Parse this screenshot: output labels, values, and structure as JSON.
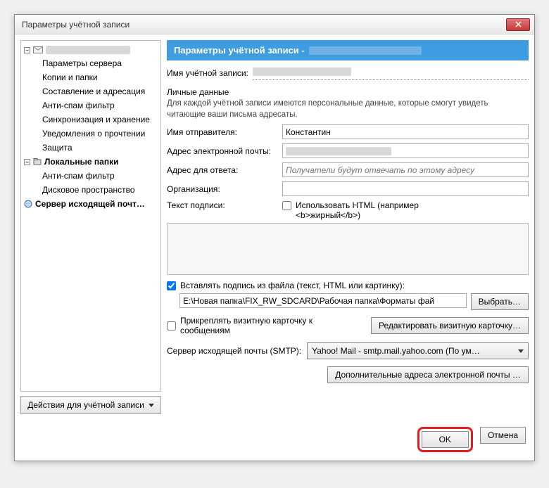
{
  "window": {
    "title": "Параметры учётной записи"
  },
  "tree": {
    "account_root_blurred": true,
    "items": [
      "Параметры сервера",
      "Копии и папки",
      "Составление и адресация",
      "Анти-спам фильтр",
      "Синхронизация и хранение",
      "Уведомления о прочтении",
      "Защита"
    ],
    "local_folders": "Локальные папки",
    "local_children": [
      "Анти-спам фильтр",
      "Дисковое пространство"
    ],
    "smtp_server": "Сервер исходящей почт…"
  },
  "account_actions_label": "Действия для учётной записи",
  "banner": {
    "prefix": "Параметры учётной записи -"
  },
  "account_name_label": "Имя учётной записи:",
  "personal": {
    "legend": "Личные данные",
    "hint": "Для каждой учётной записи имеются персональные данные, которые смогут увидеть читающие ваши письма адресаты.",
    "sender_label": "Имя отправителя:",
    "sender_value": "Константин",
    "email_label": "Адрес электронной почты:",
    "email_value": "",
    "reply_label": "Адрес для ответа:",
    "reply_placeholder": "Получатели будут отвечать по этому адресу",
    "org_label": "Организация:",
    "org_value": "",
    "sig_label": "Текст подписи:",
    "use_html_label": "Использовать HTML (например <b>жирный</b>)"
  },
  "sig_file": {
    "check_label": "Вставлять подпись из файла (текст, HTML или картинку):",
    "path": "E:\\Новая папка\\FIX_RW_SDCARD\\Рабочая папка\\Форматы фай",
    "choose_btn": "Выбрать…"
  },
  "vcard": {
    "check_label": "Прикреплять визитную карточку к сообщениям",
    "edit_btn": "Редактировать визитную карточку…"
  },
  "smtp": {
    "label": "Сервер исходящей почты (SMTP):",
    "selected": "Yahoo! Mail - smtp.mail.yahoo.com (По ум…"
  },
  "extra_emails_btn": "Дополнительные адреса электронной почты …",
  "footer": {
    "ok": "OK",
    "cancel": "Отмена"
  }
}
